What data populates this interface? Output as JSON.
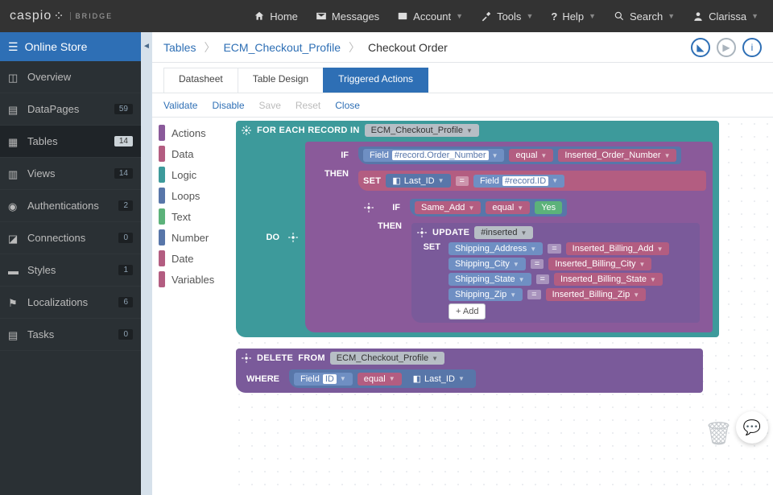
{
  "brand": {
    "name": "caspio",
    "sub": "BRIDGE"
  },
  "topnav": [
    {
      "label": "Home"
    },
    {
      "label": "Messages"
    },
    {
      "label": "Account"
    },
    {
      "label": "Tools"
    },
    {
      "label": "Help"
    },
    {
      "label": "Search"
    },
    {
      "label": "Clarissa"
    }
  ],
  "sidebar": {
    "title": "Online Store",
    "items": [
      {
        "label": "Overview",
        "badge": ""
      },
      {
        "label": "DataPages",
        "badge": "59"
      },
      {
        "label": "Tables",
        "badge": "14",
        "selected": true
      },
      {
        "label": "Views",
        "badge": "14"
      },
      {
        "label": "Authentications",
        "badge": "2"
      },
      {
        "label": "Connections",
        "badge": "0"
      },
      {
        "label": "Styles",
        "badge": "1"
      },
      {
        "label": "Localizations",
        "badge": "6"
      },
      {
        "label": "Tasks",
        "badge": "0"
      }
    ]
  },
  "crumbs": [
    "Tables",
    "ECM_Checkout_Profile",
    "Checkout Order"
  ],
  "tabs": [
    "Datasheet",
    "Table Design",
    "Triggered Actions"
  ],
  "toolbar": [
    {
      "label": "Validate",
      "enabled": true
    },
    {
      "label": "Disable",
      "enabled": true
    },
    {
      "label": "Save",
      "enabled": false
    },
    {
      "label": "Reset",
      "enabled": false
    },
    {
      "label": "Close",
      "enabled": true
    }
  ],
  "palette": [
    {
      "label": "Actions",
      "color": "#8a5a9a"
    },
    {
      "label": "Data",
      "color": "#b35d81"
    },
    {
      "label": "Logic",
      "color": "#3d9a9b"
    },
    {
      "label": "Loops",
      "color": "#5876a9"
    },
    {
      "label": "Text",
      "color": "#5cb27a"
    },
    {
      "label": "Number",
      "color": "#5876a9"
    },
    {
      "label": "Date",
      "color": "#b35d81"
    },
    {
      "label": "Variables",
      "color": "#b35d81"
    }
  ],
  "blocks": {
    "foreach": {
      "kw": "FOR EACH RECORD IN",
      "table": "ECM_Checkout_Profile",
      "do": "DO"
    },
    "if1": {
      "kw": "IF",
      "then": "THEN",
      "left_field": "Field",
      "left_val": "#record.Order_Number",
      "op": "equal",
      "right_val": "Inserted_Order_Number"
    },
    "set1": {
      "kw": "SET",
      "var": "Last_ID",
      "eq": "=",
      "field": "Field",
      "val": "#record.ID"
    },
    "if2": {
      "kw": "IF",
      "then": "THEN",
      "left_val": "Same_Add",
      "op": "equal",
      "right": "Yes"
    },
    "update": {
      "kw": "UPDATE",
      "target": "#inserted",
      "set": "SET",
      "rows": [
        {
          "l": "Shipping_Address",
          "r": "Inserted_Billing_Add"
        },
        {
          "l": "Shipping_City",
          "r": "Inserted_Billing_City"
        },
        {
          "l": "Shipping_State",
          "r": "Inserted_Billing_State"
        },
        {
          "l": "Shipping_Zip",
          "r": "Inserted_Billing_Zip"
        }
      ],
      "add": "+ Add"
    },
    "delete": {
      "kw": "DELETE",
      "from": "FROM",
      "table": "ECM_Checkout_Profile",
      "where": "WHERE",
      "field": "Field",
      "fval": "ID",
      "op": "equal",
      "rvar": "Last_ID"
    }
  }
}
